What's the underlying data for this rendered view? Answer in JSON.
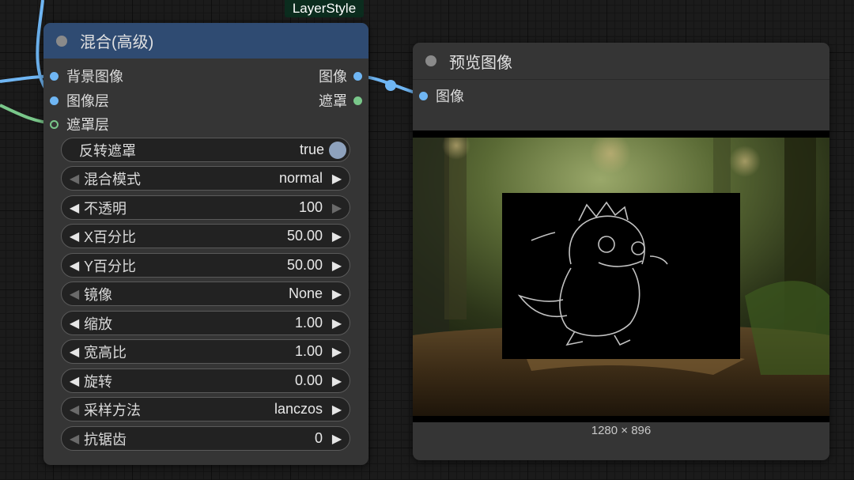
{
  "group": {
    "title": "LayerStyle"
  },
  "blend_node": {
    "title": "混合(高级)",
    "inputs": [
      {
        "label": "背景图像"
      },
      {
        "label": "图像层"
      },
      {
        "label": "遮罩层"
      }
    ],
    "outputs": [
      {
        "label": "图像"
      },
      {
        "label": "遮罩"
      }
    ],
    "invert_mask": {
      "label": "反转遮罩",
      "value": "true"
    },
    "widgets": [
      {
        "label": "混合模式",
        "value": "normal"
      },
      {
        "label": "不透明",
        "value": "100"
      },
      {
        "label": "X百分比",
        "value": "50.00"
      },
      {
        "label": "Y百分比",
        "value": "50.00"
      },
      {
        "label": "镜像",
        "value": "None"
      },
      {
        "label": "缩放",
        "value": "1.00"
      },
      {
        "label": "宽高比",
        "value": "1.00"
      },
      {
        "label": "旋转",
        "value": "0.00"
      },
      {
        "label": "采样方法",
        "value": "lanczos"
      },
      {
        "label": "抗锯齿",
        "value": "0"
      }
    ]
  },
  "preview_node": {
    "title": "预览图像",
    "input_label": "图像",
    "image_size": "1280 × 896"
  },
  "colors": {
    "blend_header": "#2f4b72",
    "group_tag": "#0b2c1e",
    "image_slot": "#6fb6f4",
    "mask_slot": "#79c78a",
    "toggle_on": "#8ea2bd"
  },
  "icons": [
    "status-dot-icon",
    "arrow-left-icon",
    "arrow-right-icon",
    "toggle-knob-icon"
  ]
}
